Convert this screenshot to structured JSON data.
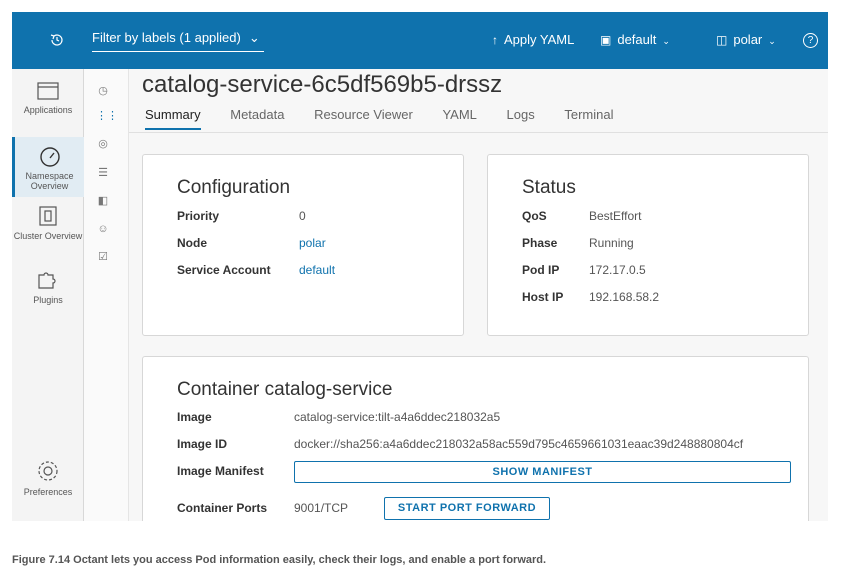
{
  "topbar": {
    "history_icon": "history-icon",
    "filter_label": "Filter by labels (1 applied)",
    "apply_yaml": "Apply YAML",
    "namespace": "default",
    "context": "polar",
    "help_icon": "help-icon",
    "accent": "#0f72ad"
  },
  "leftnav": {
    "items": [
      {
        "label": "Applications",
        "icon": "applications-icon"
      },
      {
        "label": "Namespace Overview",
        "icon": "dashboard-icon"
      },
      {
        "label": "Cluster Overview",
        "icon": "cluster-icon"
      },
      {
        "label": "Plugins",
        "icon": "puzzle-icon"
      },
      {
        "label": "Preferences",
        "icon": "gear-icon"
      }
    ]
  },
  "subnav": {
    "icons": [
      "dashboard-icon",
      "workloads-icon",
      "discovery-icon",
      "storage-icon",
      "config-icon",
      "rbac-icon",
      "events-icon"
    ]
  },
  "page": {
    "title": "catalog-service-6c5df569b5-drssz",
    "tabs": [
      "Summary",
      "Metadata",
      "Resource Viewer",
      "YAML",
      "Logs",
      "Terminal"
    ],
    "active_tab": "Summary"
  },
  "configuration": {
    "heading": "Configuration",
    "rows": [
      {
        "label": "Priority",
        "value": "0"
      },
      {
        "label": "Node",
        "value": "polar"
      },
      {
        "label": "Service Account",
        "value": "default"
      }
    ]
  },
  "status": {
    "heading": "Status",
    "rows": [
      {
        "label": "QoS",
        "value": "BestEffort"
      },
      {
        "label": "Phase",
        "value": "Running"
      },
      {
        "label": "Pod IP",
        "value": "172.17.0.5"
      },
      {
        "label": "Host IP",
        "value": "192.168.58.2"
      }
    ]
  },
  "container": {
    "heading": "Container catalog-service",
    "image_label": "Image",
    "image_value": "catalog-service:tilt-a4a6ddec218032a5",
    "image_id_label": "Image ID",
    "image_id_value": "docker://sha256:a4a6ddec218032a58ac559d795c4659661031eaac39d248880804cf",
    "manifest_label": "Image Manifest",
    "manifest_button": "SHOW MANIFEST",
    "ports_label": "Container Ports",
    "ports_value": "9001/TCP",
    "port_forward_button": "START PORT FORWARD"
  },
  "caption": "Figure 7.14   Octant lets you access Pod information easily, check their logs, and enable a port forward."
}
